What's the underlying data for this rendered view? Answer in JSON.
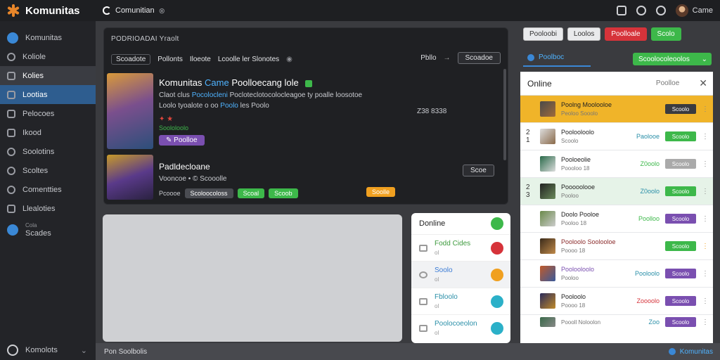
{
  "app": {
    "name": "Komunitas",
    "search_label": "Comunitian",
    "user_name": "Came"
  },
  "sidebar": {
    "items": [
      {
        "label": "Komunitas"
      },
      {
        "label": "Koliole"
      },
      {
        "label": "Kolies"
      },
      {
        "label": "Lootias"
      },
      {
        "label": "Pelocoes"
      },
      {
        "label": "Ikood"
      },
      {
        "label": "Soolotins"
      },
      {
        "label": "Scoltes"
      },
      {
        "label": "Comentties"
      },
      {
        "label": "Llealoties"
      },
      {
        "label": "Scades",
        "caption": "Cola"
      }
    ],
    "footer_label": "Komolots"
  },
  "game_panel": {
    "title": "PODRIOADAI Yraolt",
    "filters": [
      "Scoadote",
      "Pollonts",
      "Iloeote",
      "Lcoolle ler Slonotes"
    ],
    "right_label": "Pbllo",
    "right_button": "Scoadoe",
    "game1": {
      "title": "Komunitas",
      "title_highlight": "Came",
      "title_rest": "Poolloecang lole",
      "desc_a": "Claot clus",
      "desc_link": "Pocolocleni",
      "desc_b": "Pocloteclotocolocleagoe ty poalle loosotoe",
      "desc_c": "Loolo tyoalote o oo",
      "desc_link2": "Poolo",
      "desc_d": "les Poolo",
      "price": "Z38 8338",
      "stars": "✦ ★",
      "meta": "Soololoolo",
      "button": "Poolloe"
    },
    "game2": {
      "title": "Padldecloane",
      "subtitle": "Vooncoe • © Scooolle",
      "meta": "Pcoooe",
      "pills": [
        "Scoloocoloss",
        "Scoal",
        "Scoob"
      ],
      "orange_pill": "Soolle",
      "button": "Scoe"
    }
  },
  "friends": {
    "title": "Donline",
    "items": [
      {
        "name": "Fodd Cides",
        "sub": "ol"
      },
      {
        "name": "Soolo",
        "sub": "ol"
      },
      {
        "name": "Fbloolo",
        "sub": "ol"
      },
      {
        "name": "Poolocoeolon",
        "sub": "ol"
      }
    ]
  },
  "statusbar": {
    "left": "Pon Soolbolis",
    "right": "Komunitas"
  },
  "right_panel": {
    "buttons": [
      "Pooloobi",
      "Loolos",
      "Poolloale",
      "Scolo"
    ],
    "tab": "Poolboc",
    "dropdown": "Scoolocoleoolos",
    "online": {
      "title": "Online",
      "mid": "Poolloe",
      "rows": [
        {
          "rank": "",
          "name": "Poolng Moolooloe",
          "sub": "Peoloo Sooolo",
          "tag": "",
          "action": "Scoolo"
        },
        {
          "rank": "2 1",
          "name": "Poolooloolo",
          "sub": "Scoolo",
          "tag": "Paolooe",
          "action": "Scoolo"
        },
        {
          "rank": "",
          "name": "Pooloeolie",
          "sub": "Poooloo 18",
          "tag": "Z0oolo",
          "action": "Scoolo"
        },
        {
          "rank": "2 3",
          "name": "Pooooolooe",
          "sub": "Pooloo",
          "tag": "Z0oolo",
          "action": "Scoolo"
        },
        {
          "rank": "",
          "name": "Doolo Pooloe",
          "sub": "Pooloo 18",
          "tag": "Poolloo",
          "action": "Scoolo"
        },
        {
          "rank": "",
          "name": "Pooloolo Soolooloe",
          "sub": "Poooo 18",
          "tag": "",
          "action": "Scoolo"
        },
        {
          "rank": "",
          "name": "Poolooloolo",
          "sub": "Pooloo",
          "tag": "Pooloolo",
          "action": "Scoolo"
        },
        {
          "rank": "",
          "name": "Pooloolo",
          "sub": "Poooo 18",
          "tag": "Zoooolo",
          "action": "Scoolo"
        },
        {
          "rank": "",
          "name": "Poooll Noloolon",
          "sub": "",
          "tag": "Zoo",
          "action": "Scoolo"
        }
      ]
    }
  },
  "colors": {
    "accent": "#3a88d6",
    "green": "#3db84a",
    "red": "#d6333a",
    "orange": "#f0a020",
    "purple": "#7a4fb0"
  }
}
